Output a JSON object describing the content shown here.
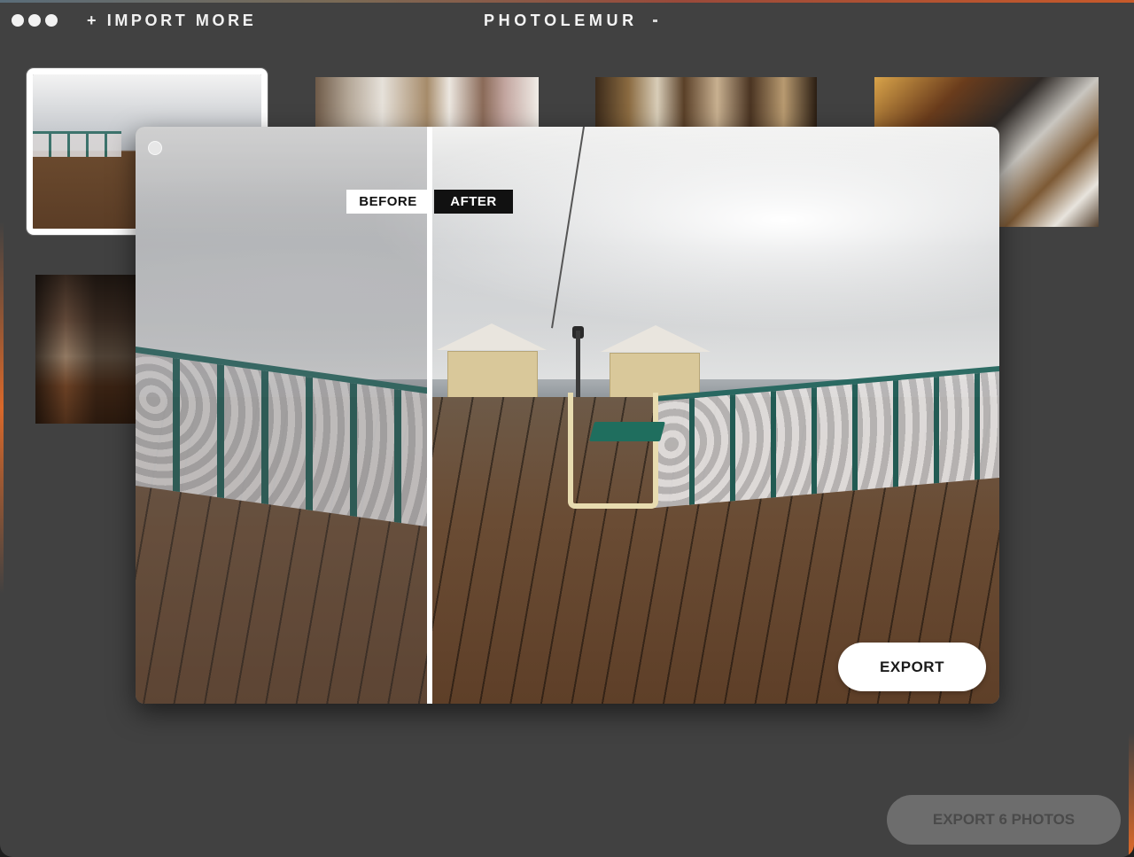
{
  "titlebar": {
    "import_more": "+ IMPORT MORE",
    "app_title": "PHOTOLEMUR",
    "title_dropdown_icon": "chevron-down-icon"
  },
  "thumbnails": [
    {
      "label": "pier",
      "selected": true
    },
    {
      "label": "church-interior-1",
      "selected": false
    },
    {
      "label": "church-interior-2",
      "selected": false
    },
    {
      "label": "church-interior-3",
      "selected": false
    },
    {
      "label": "church-pews",
      "selected": false
    }
  ],
  "preview": {
    "before_label": "BEFORE",
    "after_label": "AFTER",
    "export_label": "EXPORT"
  },
  "footer": {
    "export_all_label": "EXPORT 6 PHOTOS"
  },
  "colors": {
    "background": "#414141",
    "accent": "#e06a28",
    "button": "#ffffff",
    "button_disabled": "#6d6d6d"
  }
}
